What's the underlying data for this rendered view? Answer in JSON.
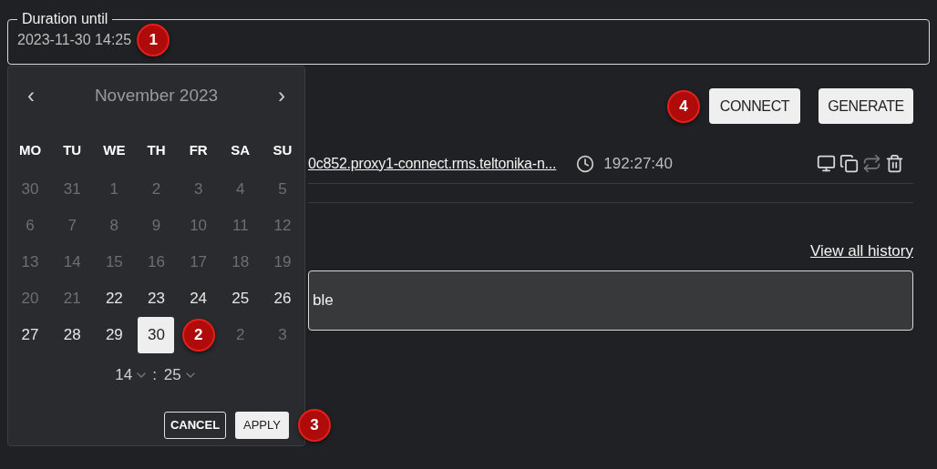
{
  "duration_field": {
    "label": "Duration until",
    "value": "2023-11-30 14:25",
    "marker": "1"
  },
  "toolbar": {
    "marker": "4",
    "buttons": [
      "CONNECT",
      "GENERATE"
    ]
  },
  "session": {
    "link": "0c852.proxy1-connect.rms.teltonika-n...",
    "time": "192:27:40",
    "actions": [
      {
        "kind": "monitor",
        "disabled": false
      },
      {
        "kind": "copy",
        "disabled": false
      },
      {
        "kind": "repeat",
        "disabled": true
      },
      {
        "kind": "trash",
        "disabled": false
      }
    ]
  },
  "history_link": "View all history",
  "notice": "ble",
  "calendar": {
    "month": "November 2023",
    "prev": "‹",
    "next": "›",
    "weekdays": [
      "MO",
      "TU",
      "WE",
      "TH",
      "FR",
      "SA",
      "SU"
    ],
    "days": [
      {
        "kind": "day",
        "label": "30",
        "outside": true,
        "selected": false
      },
      {
        "kind": "day",
        "label": "31",
        "outside": true,
        "selected": false
      },
      {
        "kind": "day",
        "label": "1",
        "outside": true,
        "selected": false
      },
      {
        "kind": "day",
        "label": "2",
        "outside": true,
        "selected": false
      },
      {
        "kind": "day",
        "label": "3",
        "outside": true,
        "selected": false
      },
      {
        "kind": "day",
        "label": "4",
        "outside": true,
        "selected": false
      },
      {
        "kind": "day",
        "label": "5",
        "outside": true,
        "selected": false
      },
      {
        "kind": "day",
        "label": "6",
        "outside": true,
        "selected": false
      },
      {
        "kind": "day",
        "label": "7",
        "outside": true,
        "selected": false
      },
      {
        "kind": "day",
        "label": "8",
        "outside": true,
        "selected": false
      },
      {
        "kind": "day",
        "label": "9",
        "outside": true,
        "selected": false
      },
      {
        "kind": "day",
        "label": "10",
        "outside": true,
        "selected": false
      },
      {
        "kind": "day",
        "label": "11",
        "outside": true,
        "selected": false
      },
      {
        "kind": "day",
        "label": "12",
        "outside": true,
        "selected": false
      },
      {
        "kind": "day",
        "label": "13",
        "outside": true,
        "selected": false
      },
      {
        "kind": "day",
        "label": "14",
        "outside": true,
        "selected": false
      },
      {
        "kind": "day",
        "label": "15",
        "outside": true,
        "selected": false
      },
      {
        "kind": "day",
        "label": "16",
        "outside": true,
        "selected": false
      },
      {
        "kind": "day",
        "label": "17",
        "outside": true,
        "selected": false
      },
      {
        "kind": "day",
        "label": "18",
        "outside": true,
        "selected": false
      },
      {
        "kind": "day",
        "label": "19",
        "outside": true,
        "selected": false
      },
      {
        "kind": "day",
        "label": "20",
        "outside": true,
        "selected": false
      },
      {
        "kind": "day",
        "label": "21",
        "outside": true,
        "selected": false
      },
      {
        "kind": "day",
        "label": "22",
        "outside": false,
        "selected": false
      },
      {
        "kind": "day",
        "label": "23",
        "outside": false,
        "selected": false
      },
      {
        "kind": "day",
        "label": "24",
        "outside": false,
        "selected": false
      },
      {
        "kind": "day",
        "label": "25",
        "outside": false,
        "selected": false
      },
      {
        "kind": "day",
        "label": "26",
        "outside": false,
        "selected": false
      },
      {
        "kind": "day",
        "label": "27",
        "outside": false,
        "selected": false
      },
      {
        "kind": "day",
        "label": "28",
        "outside": false,
        "selected": false
      },
      {
        "kind": "day",
        "label": "29",
        "outside": false,
        "selected": false
      },
      {
        "kind": "day",
        "label": "30",
        "outside": false,
        "selected": true
      },
      {
        "kind": "marker",
        "label": "2"
      },
      {
        "kind": "day",
        "label": "2",
        "outside": true,
        "selected": false
      },
      {
        "kind": "day",
        "label": "3",
        "outside": true,
        "selected": false
      }
    ],
    "hour": "14",
    "separator": ":",
    "minute": "25",
    "cancel": "CANCEL",
    "apply": "APPLY",
    "marker": "3"
  }
}
